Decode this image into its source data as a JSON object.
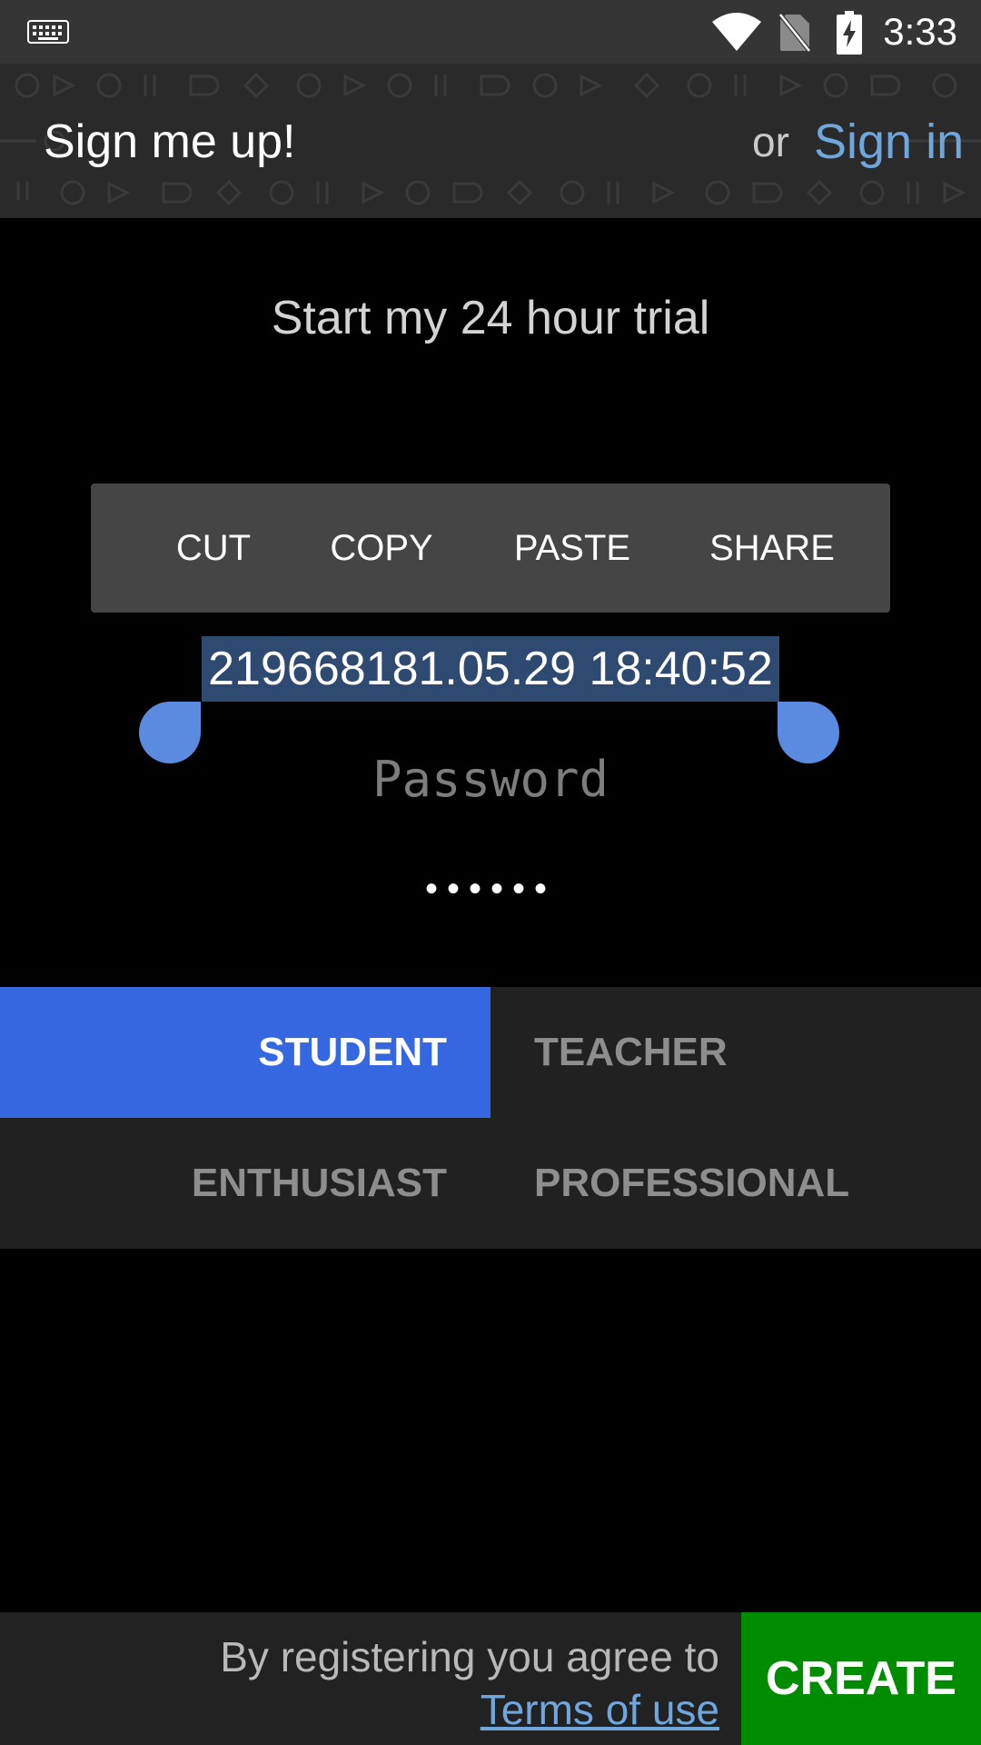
{
  "status_bar": {
    "time": "3:33",
    "icons": [
      "keyboard-icon",
      "wifi-icon",
      "no-sim-icon",
      "battery-charging-icon"
    ]
  },
  "header": {
    "title": "Sign me up!",
    "or_text": "or",
    "signin_label": "Sign in"
  },
  "form": {
    "heading": "Start my 24 hour trial",
    "email_value": "219668181.05.29 18:40:52",
    "password_placeholder": "Password",
    "password_value": "••••••"
  },
  "context_menu": {
    "items": [
      "CUT",
      "COPY",
      "PASTE",
      "SHARE"
    ]
  },
  "roles": {
    "options": [
      "STUDENT",
      "TEACHER",
      "ENTHUSIAST",
      "PROFESSIONAL"
    ],
    "selected": "STUDENT"
  },
  "footer": {
    "agree_text": "By registering you agree to",
    "terms_label": "Terms of use",
    "create_label": "CREATE"
  },
  "colors": {
    "accent_link": "#6fa6dc",
    "selected_role": "#3467e0",
    "create_button": "#008c00",
    "selection_highlight": "#2e4a70"
  }
}
